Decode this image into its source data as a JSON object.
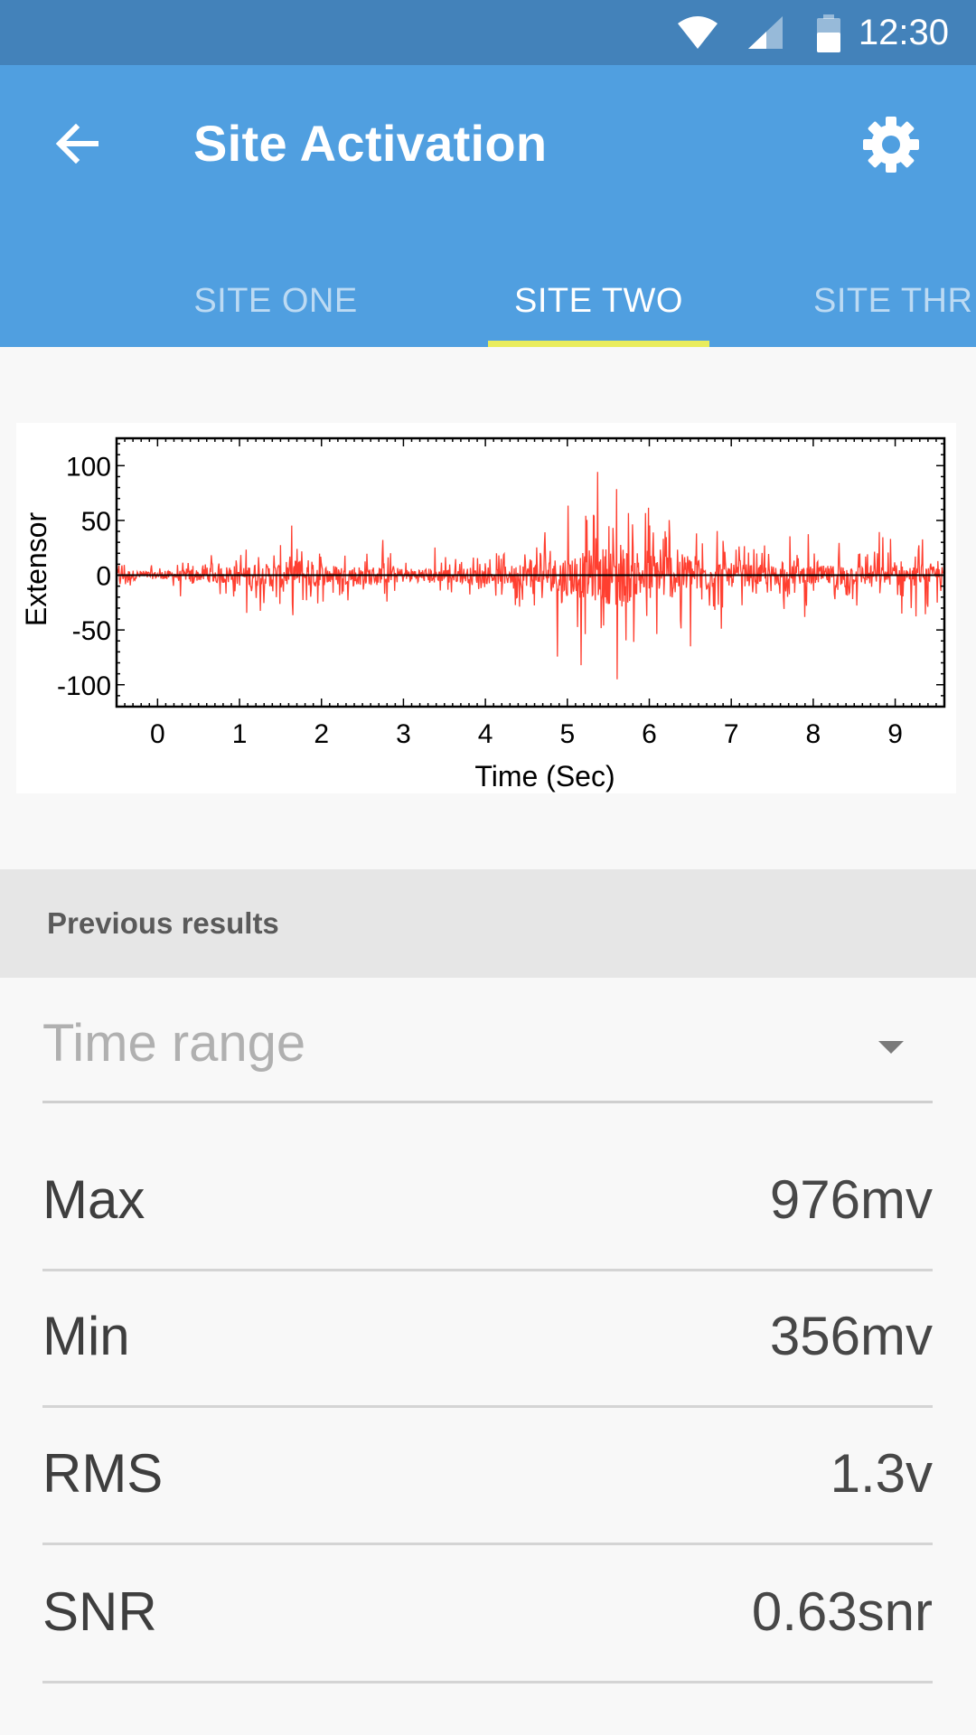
{
  "status_bar": {
    "time": "12:30",
    "icons": [
      "wifi-icon",
      "cellular-signal-icon",
      "battery-icon"
    ]
  },
  "app_bar": {
    "title": "Site Activation",
    "back_icon": "arrow-back-icon",
    "settings_icon": "gear-icon",
    "colors": {
      "status": "#4382ba",
      "toolbar": "#509fe0",
      "indicator": "#e9ec5d"
    }
  },
  "tabs": [
    {
      "label": "SITE ONE",
      "active": false
    },
    {
      "label": "SITE TWO",
      "active": true
    },
    {
      "label": "SITE THR",
      "active": false
    }
  ],
  "chart_data": {
    "type": "line",
    "title": "",
    "xlabel": "Time (Sec)",
    "ylabel": "Extensor",
    "xlim": [
      -0.5,
      9.6
    ],
    "ylim": [
      -120,
      125
    ],
    "x_ticks": [
      "0",
      "1",
      "2",
      "3",
      "4",
      "5",
      "6",
      "7",
      "8",
      "9"
    ],
    "y_ticks": [
      "100",
      "50",
      "0",
      "-50",
      "-100"
    ],
    "grid": false,
    "series_color": "#ff2a1a",
    "baseline": 0,
    "envelope": {
      "x": [
        -0.5,
        0.0,
        0.5,
        1.0,
        1.5,
        2.0,
        2.5,
        3.0,
        3.5,
        4.0,
        4.5,
        5.0,
        5.5,
        6.0,
        6.5,
        7.0,
        7.5,
        8.0,
        8.5,
        9.0,
        9.6
      ],
      "amplitude": [
        25,
        15,
        25,
        45,
        50,
        45,
        40,
        30,
        28,
        35,
        45,
        85,
        120,
        115,
        80,
        50,
        40,
        38,
        45,
        40,
        35
      ]
    }
  },
  "previous_results": {
    "title": "Previous results",
    "time_range_placeholder": "Time range",
    "rows": [
      {
        "label": "Max",
        "value": "976mv"
      },
      {
        "label": "Min",
        "value": "356mv"
      },
      {
        "label": "RMS",
        "value": "1.3v"
      },
      {
        "label": "SNR",
        "value": "0.63snr"
      }
    ]
  }
}
